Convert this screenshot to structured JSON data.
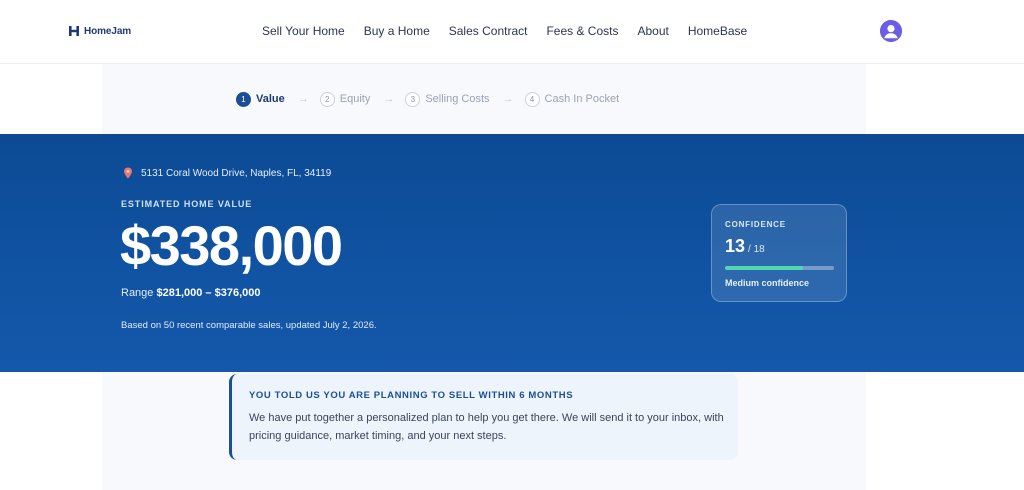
{
  "brand": {
    "name": "HomeJam",
    "color": "#1d3a74"
  },
  "nav": {
    "items": [
      {
        "label": "Sell Your Home"
      },
      {
        "label": "Buy a Home"
      },
      {
        "label": "Sales Contract"
      },
      {
        "label": "Fees & Costs"
      },
      {
        "label": "About"
      },
      {
        "label": "HomeBase"
      }
    ]
  },
  "user": {
    "avatar_icon": "user-avatar-icon",
    "avatar_color": "#6c5ce7"
  },
  "stepper": {
    "steps": [
      {
        "num": "1",
        "label": "Value",
        "active": true
      },
      {
        "num": "2",
        "label": "Equity",
        "active": false
      },
      {
        "num": "3",
        "label": "Selling Costs",
        "active": false
      },
      {
        "num": "4",
        "label": "Cash In Pocket",
        "active": false
      }
    ],
    "arrow": "→"
  },
  "hero": {
    "address": "5131 Coral Wood Drive, Naples, FL, 34119",
    "eyebrow": "ESTIMATED HOME VALUE",
    "value": "$338,000",
    "range_label": "Range",
    "range_value": "$281,000 – $376,000",
    "note": "Based on 50 recent comparable sales, updated July 2, 2026."
  },
  "confidence": {
    "label": "CONFIDENCE",
    "score": "13",
    "out_of": "/ 18",
    "fill_fraction": 0.72,
    "caption": "Medium confidence",
    "accent": "#55d6b2"
  },
  "plan": {
    "title": "YOU TOLD US YOU ARE PLANNING TO SELL WITHIN 6 MONTHS",
    "body": "We have put together a personalized plan to help you get there. We will send it to your inbox, with pricing guidance, market timing, and your next steps."
  }
}
